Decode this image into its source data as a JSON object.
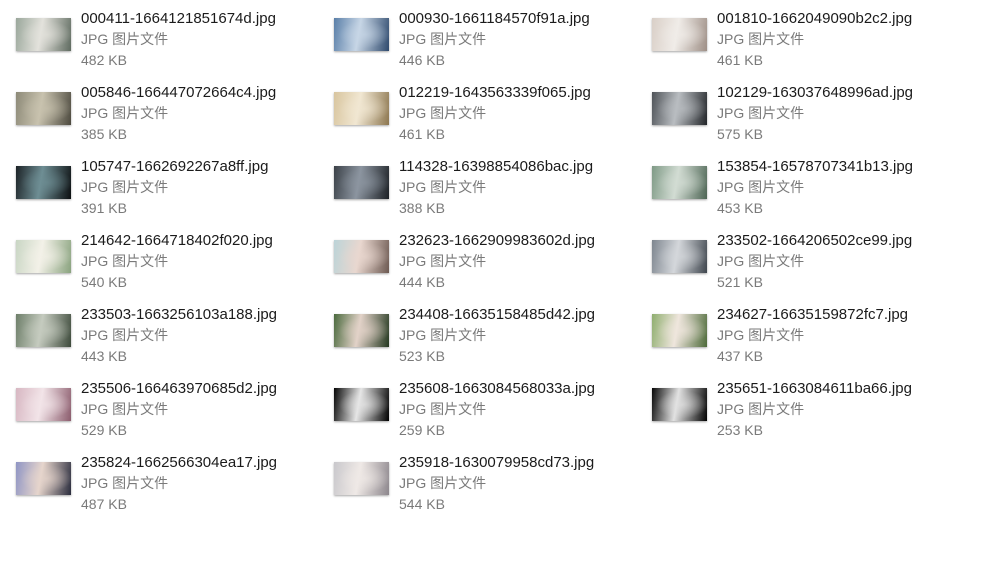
{
  "files": [
    {
      "name": "000411-1664121851674d.jpg",
      "type": "JPG 图片文件",
      "size": "482 KB",
      "thumb_colors": [
        "#9aa79b",
        "#e3e2dc",
        "#5f6b60"
      ]
    },
    {
      "name": "000930-1661184570f91a.jpg",
      "type": "JPG 图片文件",
      "size": "446 KB",
      "thumb_colors": [
        "#5a7fa8",
        "#c7d6e6",
        "#2f4a6d"
      ]
    },
    {
      "name": "001810-1662049090b2c2.jpg",
      "type": "JPG 图片文件",
      "size": "461 KB",
      "thumb_colors": [
        "#d9cfc7",
        "#f0ece8",
        "#9e8f86"
      ]
    },
    {
      "name": "005846-166447072664c4.jpg",
      "type": "JPG 图片文件",
      "size": "385 KB",
      "thumb_colors": [
        "#8d8a78",
        "#c8c2ae",
        "#4d4a3f"
      ]
    },
    {
      "name": "012219-1643563339f065.jpg",
      "type": "JPG 图片文件",
      "size": "461 KB",
      "thumb_colors": [
        "#d8c59f",
        "#f1e7d2",
        "#8d7750"
      ]
    },
    {
      "name": "102129-163037648996ad.jpg",
      "type": "JPG 图片文件",
      "size": "575 KB",
      "thumb_colors": [
        "#4f5358",
        "#b9bdc1",
        "#23262a"
      ]
    },
    {
      "name": "105747-1662692267a8ff.jpg",
      "type": "JPG 图片文件",
      "size": "391 KB",
      "thumb_colors": [
        "#1c2226",
        "#6e8e94",
        "#0c0f11"
      ]
    },
    {
      "name": "114328-16398854086bac.jpg",
      "type": "JPG 图片文件",
      "size": "388 KB",
      "thumb_colors": [
        "#3b4148",
        "#8c95a0",
        "#1d2126"
      ]
    },
    {
      "name": "153854-16578707341b13.jpg",
      "type": "JPG 图片文件",
      "size": "453 KB",
      "thumb_colors": [
        "#7f9a86",
        "#d2dcd3",
        "#4e6655"
      ]
    },
    {
      "name": "214642-1664718402f020.jpg",
      "type": "JPG 图片文件",
      "size": "540 KB",
      "thumb_colors": [
        "#c9d6c4",
        "#f3f1e8",
        "#8aa37f"
      ]
    },
    {
      "name": "232623-1662909983602d.jpg",
      "type": "JPG 图片文件",
      "size": "444 KB",
      "thumb_colors": [
        "#bcd4d8",
        "#e9d7cf",
        "#6d5a52"
      ]
    },
    {
      "name": "233502-1664206502ce99.jpg",
      "type": "JPG 图片文件",
      "size": "521 KB",
      "thumb_colors": [
        "#7e868f",
        "#d4d7db",
        "#3f464e"
      ]
    },
    {
      "name": "233503-1663256103a188.jpg",
      "type": "JPG 图片文件",
      "size": "443 KB",
      "thumb_colors": [
        "#6e7f6a",
        "#c5cbbf",
        "#3d4a3b"
      ]
    },
    {
      "name": "234408-16635158485d42.jpg",
      "type": "JPG 图片文件",
      "size": "523 KB",
      "thumb_colors": [
        "#4b6a3e",
        "#e2d2c8",
        "#243820"
      ]
    },
    {
      "name": "234627-16635159872fc7.jpg",
      "type": "JPG 图片文件",
      "size": "437 KB",
      "thumb_colors": [
        "#8fae6f",
        "#efe6dd",
        "#4e6b3a"
      ]
    },
    {
      "name": "235506-166463970685d2.jpg",
      "type": "JPG 图片文件",
      "size": "529 KB",
      "thumb_colors": [
        "#d7b7c2",
        "#f2e4e8",
        "#8c5d6e"
      ]
    },
    {
      "name": "235608-1663084568033a.jpg",
      "type": "JPG 图片文件",
      "size": "259 KB",
      "thumb_colors": [
        "#050505",
        "#e6e6e6",
        "#000000"
      ]
    },
    {
      "name": "235651-1663084611ba66.jpg",
      "type": "JPG 图片文件",
      "size": "253 KB",
      "thumb_colors": [
        "#060606",
        "#e2e2e2",
        "#000000"
      ]
    },
    {
      "name": "235824-1662566304ea17.jpg",
      "type": "JPG 图片文件",
      "size": "487 KB",
      "thumb_colors": [
        "#8f95c4",
        "#e6d5cc",
        "#2a2c3d"
      ]
    },
    {
      "name": "235918-1630079958cd73.jpg",
      "type": "JPG 图片文件",
      "size": "544 KB",
      "thumb_colors": [
        "#c9c8cc",
        "#efe9e6",
        "#8d878d"
      ]
    }
  ]
}
